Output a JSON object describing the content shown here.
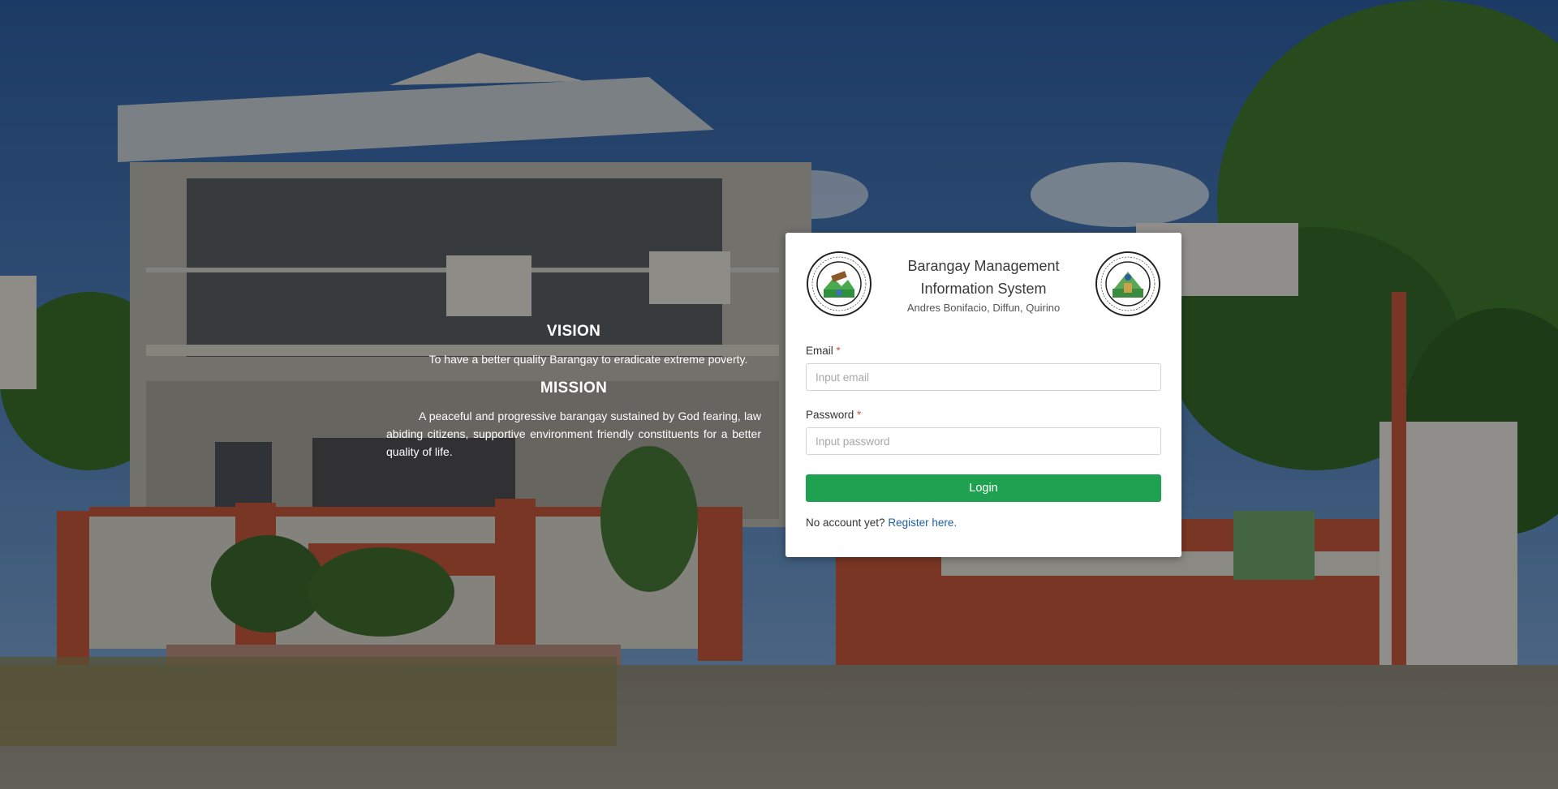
{
  "vision": {
    "heading": "VISION",
    "text": "To have a better quality Barangay to eradicate extreme poverty."
  },
  "mission": {
    "heading": "MISSION",
    "text": "A peaceful and progressive barangay sustained by God fearing, law abiding citizens, supportive environment friendly constituents for a better quality of life."
  },
  "card": {
    "title_line1": "Barangay Management",
    "title_line2": "Information System",
    "subtitle": "Andres Bonifacio, Diffun, Quirino",
    "seal_left_text": "BAYAN NG DIFFUN · LALAWIGAN NG QUIRINO",
    "seal_right_text": "BARANGAY ANDRES BONIFACIO · DIFFUN, QUIRINO"
  },
  "form": {
    "email_label": "Email",
    "email_placeholder": "Input email",
    "email_value": "",
    "password_label": "Password",
    "password_placeholder": "Input password",
    "password_value": "",
    "required_mark": "*",
    "login_label": "Login",
    "no_account_text": "No account yet?",
    "register_link": "Register here."
  },
  "colors": {
    "login_button": "#1fa152",
    "link": "#1f5fa6",
    "required": "#d9534f"
  }
}
